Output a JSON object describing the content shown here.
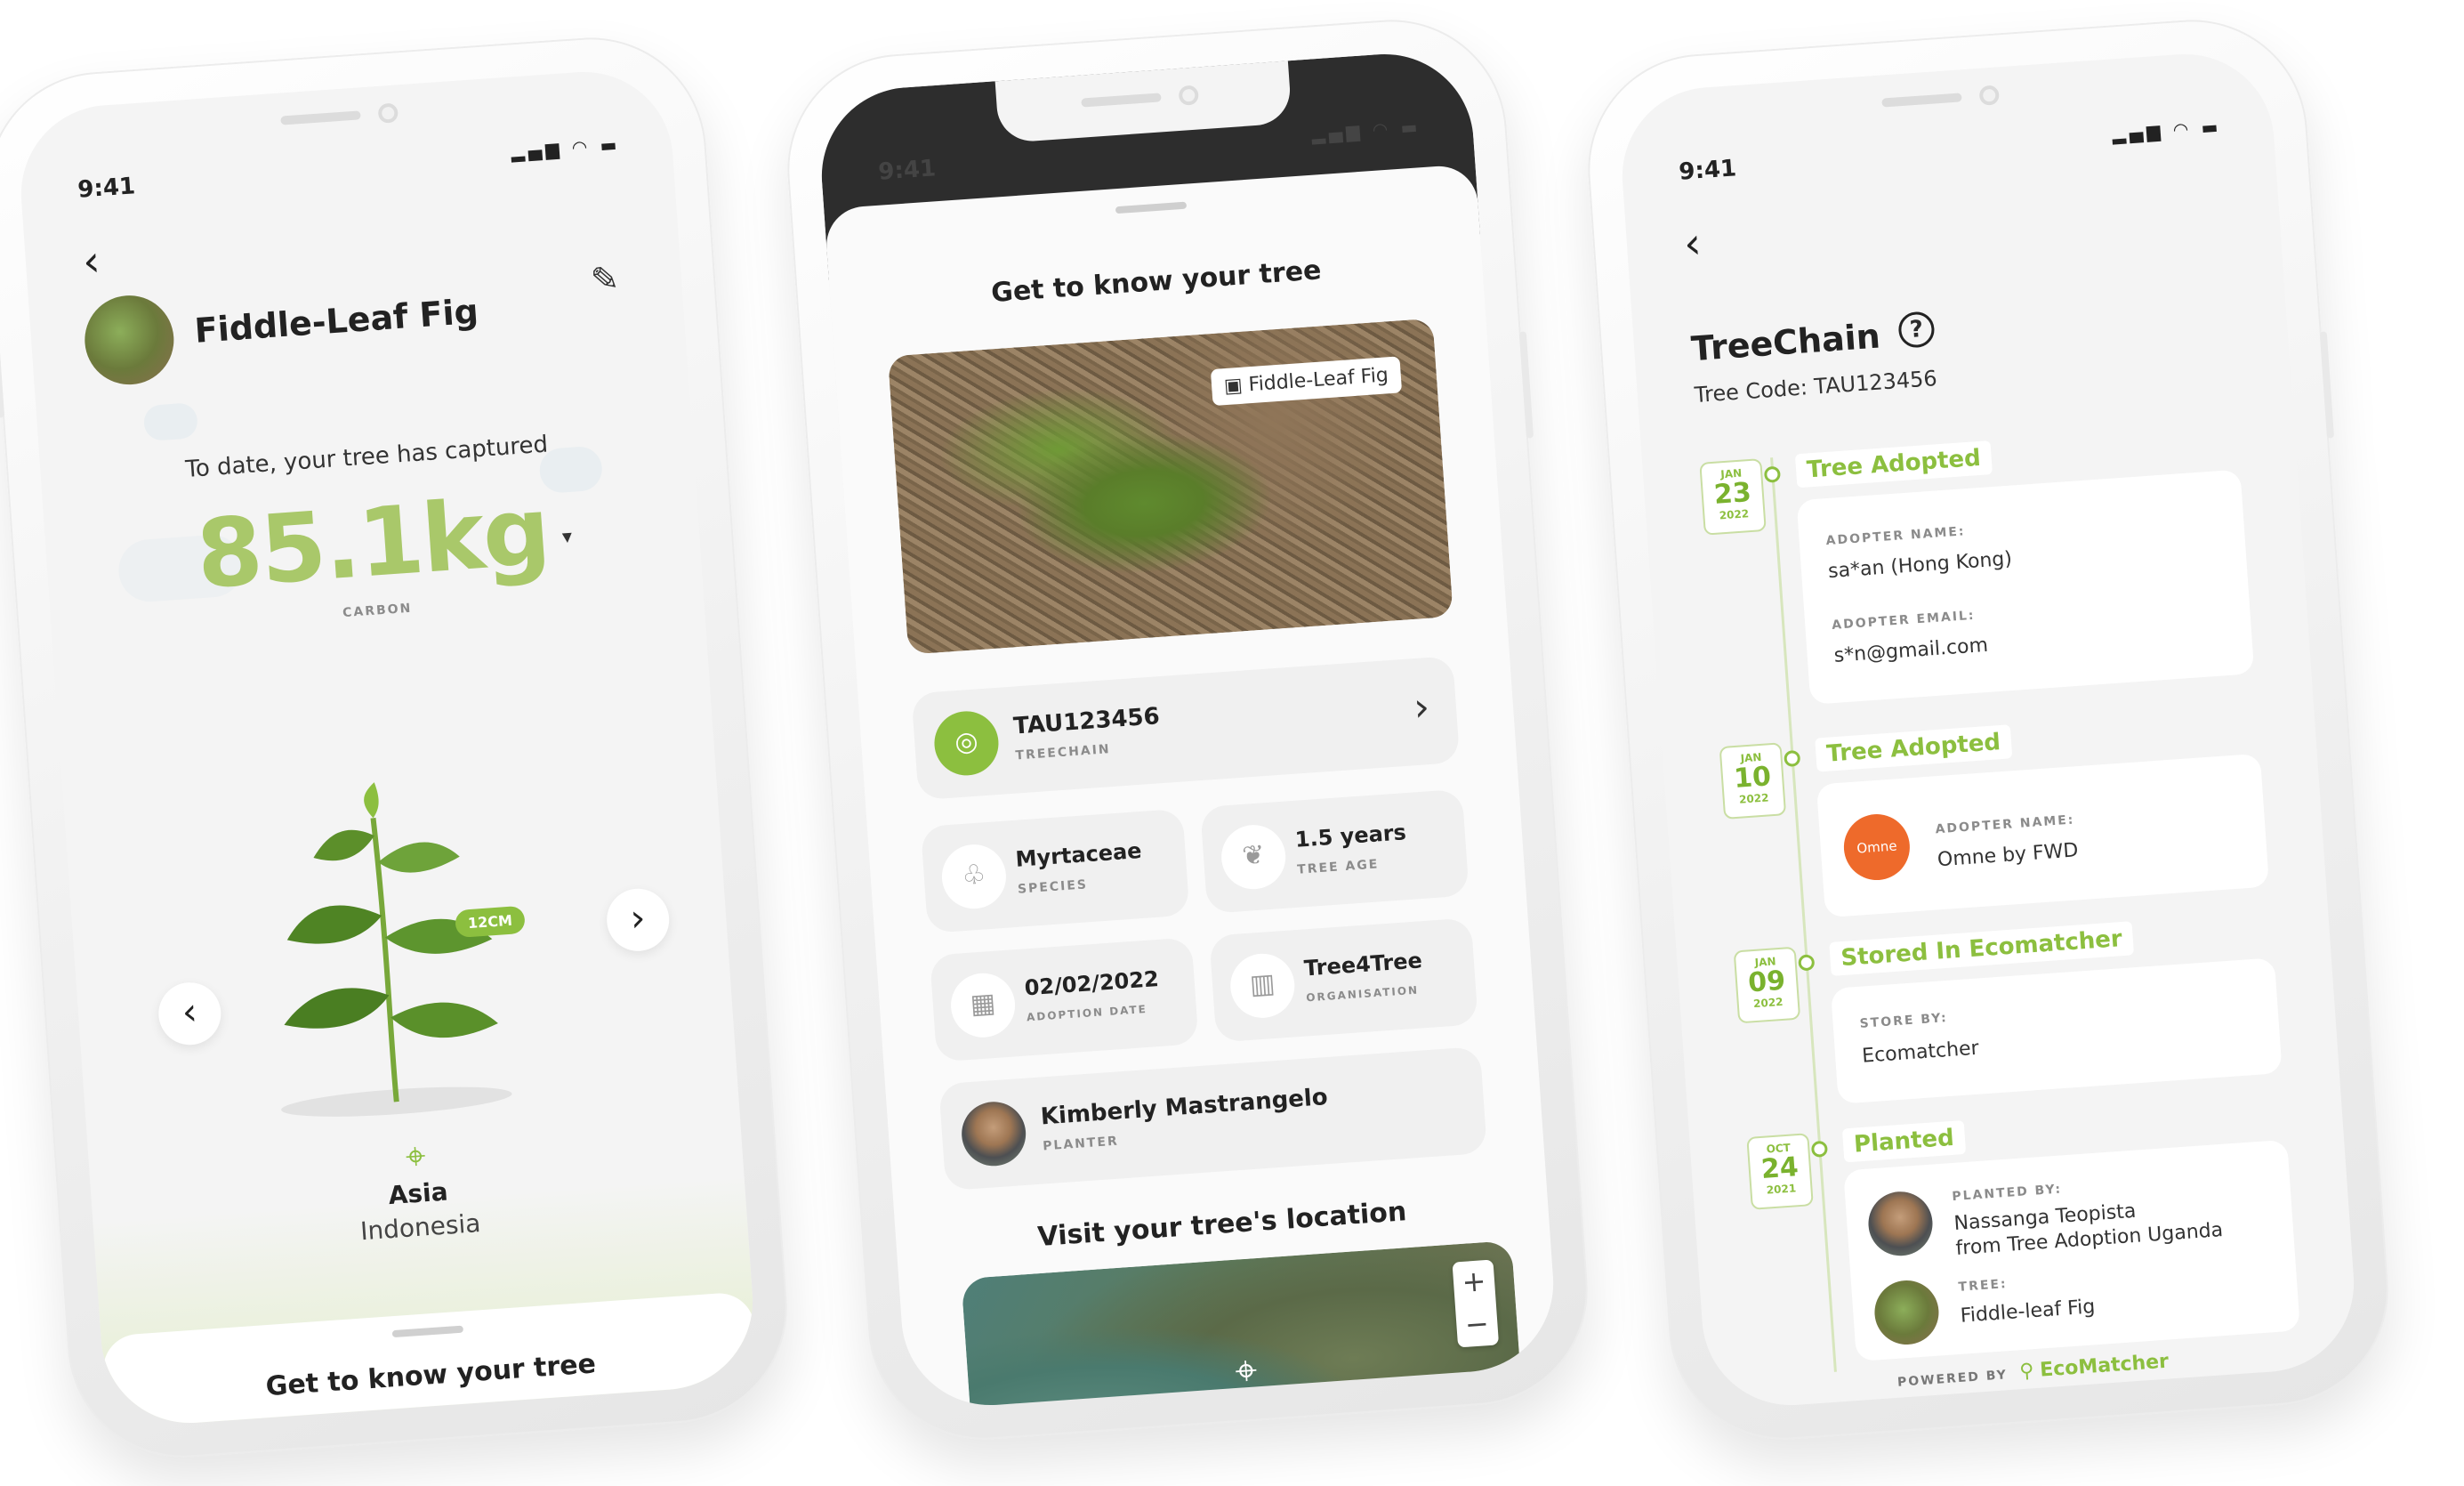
{
  "colors": {
    "accent": "#8cbf3f",
    "accent_dark": "#7ab22e",
    "bg": "#f4f4f4",
    "dark": "#2d2d2d"
  },
  "phone1": {
    "time": "9:41",
    "tree_name": "Fiddle-Leaf Fig",
    "captured_label": "To date, your tree has captured",
    "carbon_value": "85.1kg",
    "carbon_label": "CARBON",
    "height_tag": "12CM",
    "region": "Asia",
    "country": "Indonesia",
    "sheet_title": "Get to know your tree",
    "icons": {
      "back": "chevron-left-icon",
      "edit": "pencil-icon",
      "prev": "chevron-left-icon",
      "next": "chevron-right-icon",
      "location": "map-pin-icon"
    }
  },
  "phone2": {
    "time": "9:41",
    "title": "Get to know your tree",
    "photo_tag": "Fiddle-Leaf Fig",
    "treechain": {
      "code": "TAU123456",
      "label": "TREECHAIN"
    },
    "species": {
      "value": "Myrtaceae",
      "label": "SPECIES"
    },
    "age": {
      "value": "1.5 years",
      "label": "TREE AGE"
    },
    "adoption": {
      "value": "02/02/2022",
      "label": "ADOPTION DATE"
    },
    "organisation": {
      "value": "Tree4Tree",
      "label": "ORGANISATION"
    },
    "planter": {
      "value": "Kimberly Mastrangelo",
      "label": "PLANTER"
    },
    "location_title": "Visit your tree's location",
    "zoom_in": "+",
    "zoom_out": "−"
  },
  "phone3": {
    "time": "9:41",
    "title": "TreeChain",
    "tree_code": "Tree Code: TAU123456",
    "events": [
      {
        "month": "JAN",
        "day": "23",
        "year": "2022",
        "title": "Tree Adopted",
        "fields": [
          {
            "label": "ADOPTER NAME:",
            "value": "sa*an (Hong Kong)"
          },
          {
            "label": "ADOPTER EMAIL:",
            "value": "s*n@gmail.com"
          }
        ]
      },
      {
        "month": "JAN",
        "day": "10",
        "year": "2022",
        "title": "Tree Adopted",
        "fields": [
          {
            "label": "ADOPTER NAME:",
            "value": "Omne by FWD"
          }
        ],
        "logo": "Omne"
      },
      {
        "month": "JAN",
        "day": "09",
        "year": "2022",
        "title": "Stored In Ecomatcher",
        "fields": [
          {
            "label": "STORE BY:",
            "value": "Ecomatcher"
          }
        ]
      },
      {
        "month": "OCT",
        "day": "24",
        "year": "2021",
        "title": "Planted",
        "fields": [
          {
            "label": "PLANTED BY:",
            "value": "Nassanga Teopista",
            "value2": "from Tree Adoption Uganda"
          },
          {
            "label": "TREE:",
            "value": "Fiddle-leaf Fig"
          }
        ]
      }
    ],
    "powered_by": "POWERED BY",
    "brand": "EcoMatcher"
  }
}
